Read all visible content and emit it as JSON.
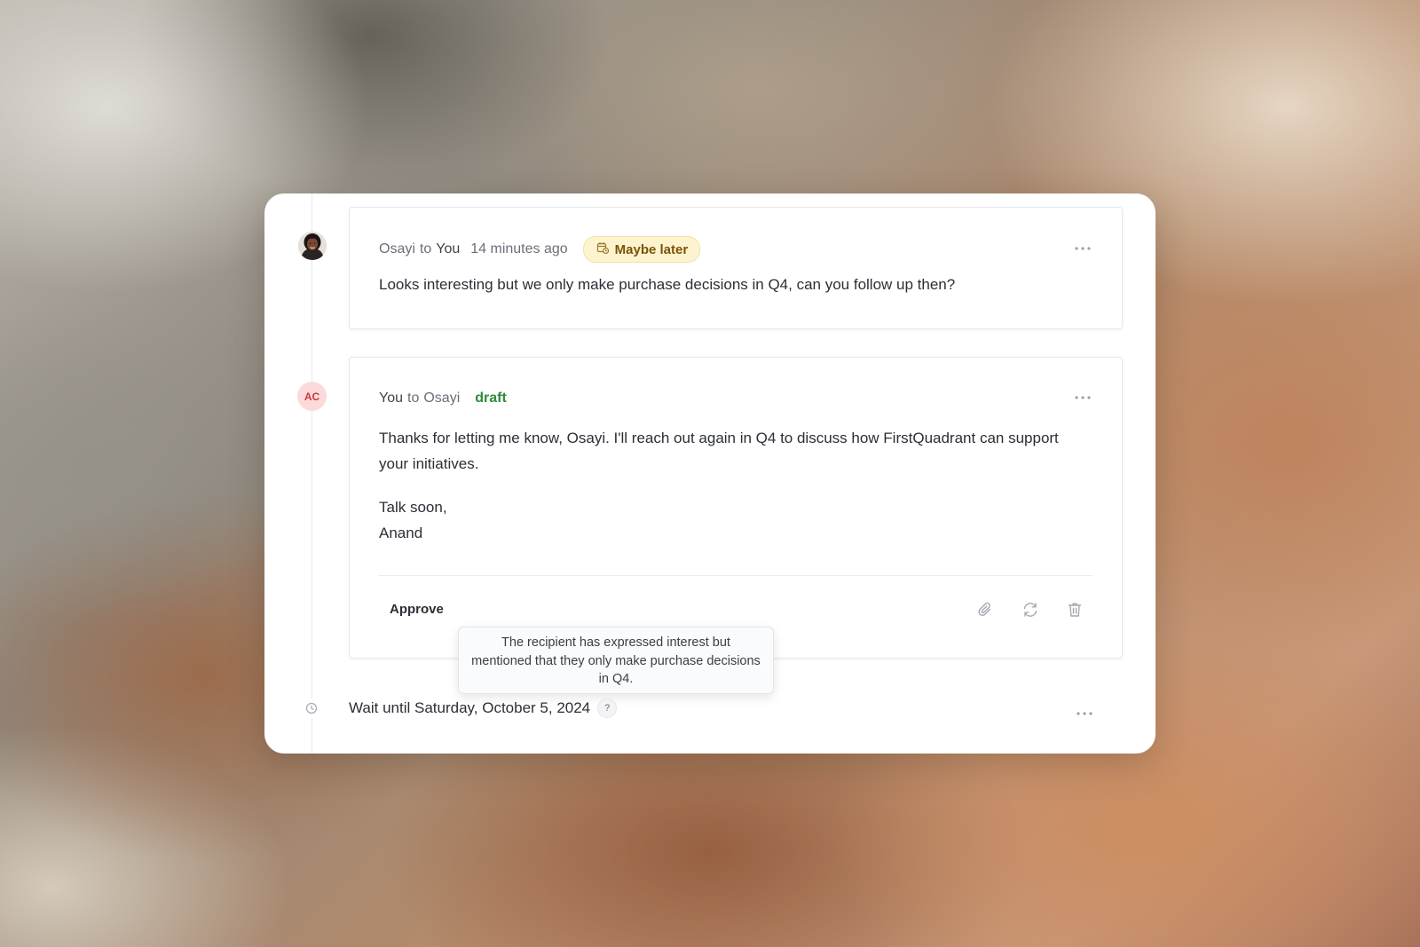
{
  "thread": {
    "incoming": {
      "sender": "Osayi",
      "connector": "to",
      "recipient": "You",
      "time": "14 minutes ago",
      "badge": {
        "label": "Maybe later",
        "icon": "calendar-clock-icon",
        "bg": "#fdf3cf",
        "color": "#7a5308"
      },
      "body": "Looks interesting but we only make purchase decisions in Q4, can you follow up then?",
      "menu_icon": "more-horizontal-icon"
    },
    "reply": {
      "avatar_initials": "AC",
      "sender": "You",
      "connector": "to",
      "recipient": "Osayi",
      "status": "draft",
      "status_color": "#2e8b3a",
      "paragraph1": "Thanks for letting me know, Osayi. I'll reach out again in Q4 to discuss how FirstQuadrant can support your initiatives.",
      "closing": "Talk soon,",
      "signature": "Anand",
      "approve_label": "Approve",
      "actions": [
        "paperclip-icon",
        "refresh-icon",
        "trash-icon"
      ],
      "menu_icon": "more-horizontal-icon"
    },
    "tooltip": "The recipient has expressed interest but mentioned that they only make purchase decisions in Q4.",
    "wait": {
      "label": "Wait until Saturday, October 5, 2024",
      "help": "?",
      "icon": "clock-icon",
      "menu_icon": "more-horizontal-icon"
    }
  }
}
